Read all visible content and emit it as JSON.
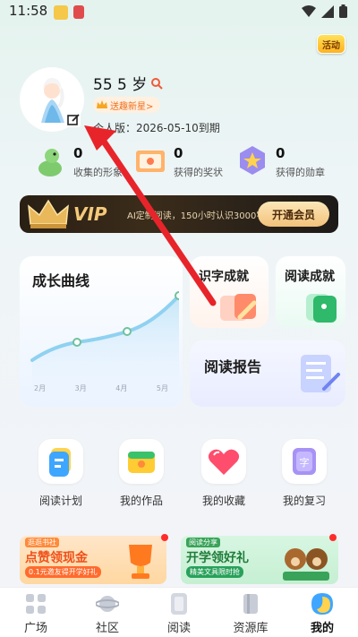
{
  "status": {
    "time": "11:58"
  },
  "event_label": "活动",
  "profile": {
    "name": "55 5 岁",
    "badge": "送趣新星>",
    "version": "个人版：2026-05-10到期"
  },
  "stats": [
    {
      "value": "0",
      "label": "收集的形象"
    },
    {
      "value": "0",
      "label": "获得的奖状"
    },
    {
      "value": "0",
      "label": "获得的勋章"
    }
  ],
  "vip": {
    "logo": "VIP",
    "desc": "AI定制阅读，150小时认识3000字",
    "button": "开通会员"
  },
  "cards": {
    "growth": "成长曲线",
    "growth_axis": [
      "2月",
      "3月",
      "4月",
      "5月"
    ],
    "literacy": "识字成就",
    "reading": "阅读成就",
    "report": "阅读报告"
  },
  "quick_links": [
    {
      "label": "阅读计划"
    },
    {
      "label": "我的作品"
    },
    {
      "label": "我的收藏"
    },
    {
      "label": "我的复习"
    }
  ],
  "banners": [
    {
      "tag": "逛逛书社",
      "title": "点赞领现金",
      "sub": "0.1元邀友得开学好礼"
    },
    {
      "tag": "阅读分享",
      "title": "开学领好礼",
      "sub": "精美文具限时抢"
    }
  ],
  "tabs": [
    {
      "label": "广场"
    },
    {
      "label": "社区"
    },
    {
      "label": "阅读"
    },
    {
      "label": "资源库"
    },
    {
      "label": "我的"
    }
  ],
  "colors": {
    "accent": "#f5c97a",
    "annotation_arrow": "#e8242b",
    "chart_line": "#8fd1f0"
  }
}
